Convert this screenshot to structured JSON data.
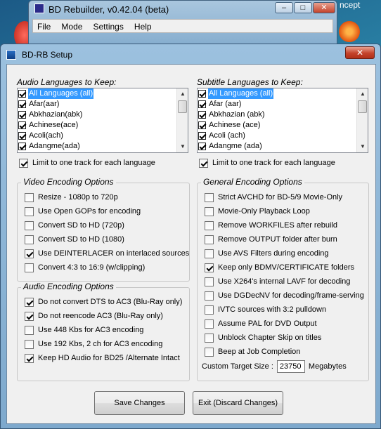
{
  "background_app": {
    "title": "BD Rebuilder, v0.42.04 (beta)",
    "menu": [
      "File",
      "Mode",
      "Settings",
      "Help"
    ],
    "controls": [
      "–",
      "□",
      "✕"
    ],
    "side_text": "ncept"
  },
  "dialog": {
    "title": "BD-RB Setup",
    "close_glyph": "✕"
  },
  "audio_languages": {
    "label": "Audio Languages to Keep:",
    "items": [
      {
        "label": "All Languages (all)",
        "checked": true,
        "selected": true
      },
      {
        "label": "Afar(aar)",
        "checked": true
      },
      {
        "label": "Abkhazian(abk)",
        "checked": true
      },
      {
        "label": "Achinese(ace)",
        "checked": true
      },
      {
        "label": "Acoli(ach)",
        "checked": true
      },
      {
        "label": "Adangme(ada)",
        "checked": true
      }
    ],
    "limit_label": "Limit to one track for each language",
    "limit_checked": true
  },
  "subtitle_languages": {
    "label": "Subtitle Languages to Keep:",
    "items": [
      {
        "label": "All Languages (all)",
        "checked": true,
        "selected": true
      },
      {
        "label": "Afar (aar)",
        "checked": true
      },
      {
        "label": "Abkhazian (abk)",
        "checked": true
      },
      {
        "label": "Achinese (ace)",
        "checked": true
      },
      {
        "label": "Acoli (ach)",
        "checked": true
      },
      {
        "label": "Adangme (ada)",
        "checked": true
      }
    ],
    "limit_label": "Limit to one track for each language",
    "limit_checked": true
  },
  "video_encoding": {
    "title": "Video Encoding Options",
    "options": [
      {
        "label": "Resize  - 1080p to 720p",
        "checked": false
      },
      {
        "label": "Use Open GOPs for encoding",
        "checked": false
      },
      {
        "label": "Convert SD to HD (720p)",
        "checked": false
      },
      {
        "label": "Convert SD to HD (1080)",
        "checked": false
      },
      {
        "label": "Use DEINTERLACER on interlaced sources",
        "checked": true
      },
      {
        "label": "Convert 4:3 to 16:9 (w/clipping)",
        "checked": false
      }
    ]
  },
  "audio_encoding": {
    "title": "Audio Encoding Options",
    "options": [
      {
        "label": "Do not convert DTS to AC3  (Blu-Ray only)",
        "checked": true
      },
      {
        "label": "Do not reencode AC3  (Blu-Ray only)",
        "checked": true
      },
      {
        "label": "Use 448 Kbs for AC3 encoding",
        "checked": false
      },
      {
        "label": "Use 192 Kbs, 2 ch for AC3 encoding",
        "checked": false
      },
      {
        "label": "Keep HD Audio for BD25 /Alternate Intact",
        "checked": true
      }
    ]
  },
  "general_encoding": {
    "title": "General Encoding Options",
    "options": [
      {
        "label": "Strict AVCHD for BD-5/9 Movie-Only",
        "checked": false
      },
      {
        "label": "Movie-Only Playback Loop",
        "checked": false
      },
      {
        "label": "Remove WORKFILES after rebuild",
        "checked": false
      },
      {
        "label": "Remove OUTPUT folder after burn",
        "checked": false
      },
      {
        "label": "Use AVS Filters during encoding",
        "checked": false
      },
      {
        "label": "Keep only BDMV/CERTIFICATE folders",
        "checked": true
      },
      {
        "label": "Use X264's internal LAVF for decoding",
        "checked": false
      },
      {
        "label": "Use DGDecNV for decoding/frame-serving",
        "checked": false
      },
      {
        "label": "IVTC sources with 3:2 pulldown",
        "checked": false
      },
      {
        "label": "Assume PAL for DVD Output",
        "checked": false
      },
      {
        "label": "Unblock Chapter Skip on titles",
        "checked": false
      },
      {
        "label": "Beep at Job Completion",
        "checked": false
      }
    ],
    "target_size_label": "Custom Target Size :",
    "target_size_value": "23750",
    "target_size_unit": "Megabytes"
  },
  "buttons": {
    "save": "Save Changes",
    "discard": "Exit (Discard Changes)"
  }
}
